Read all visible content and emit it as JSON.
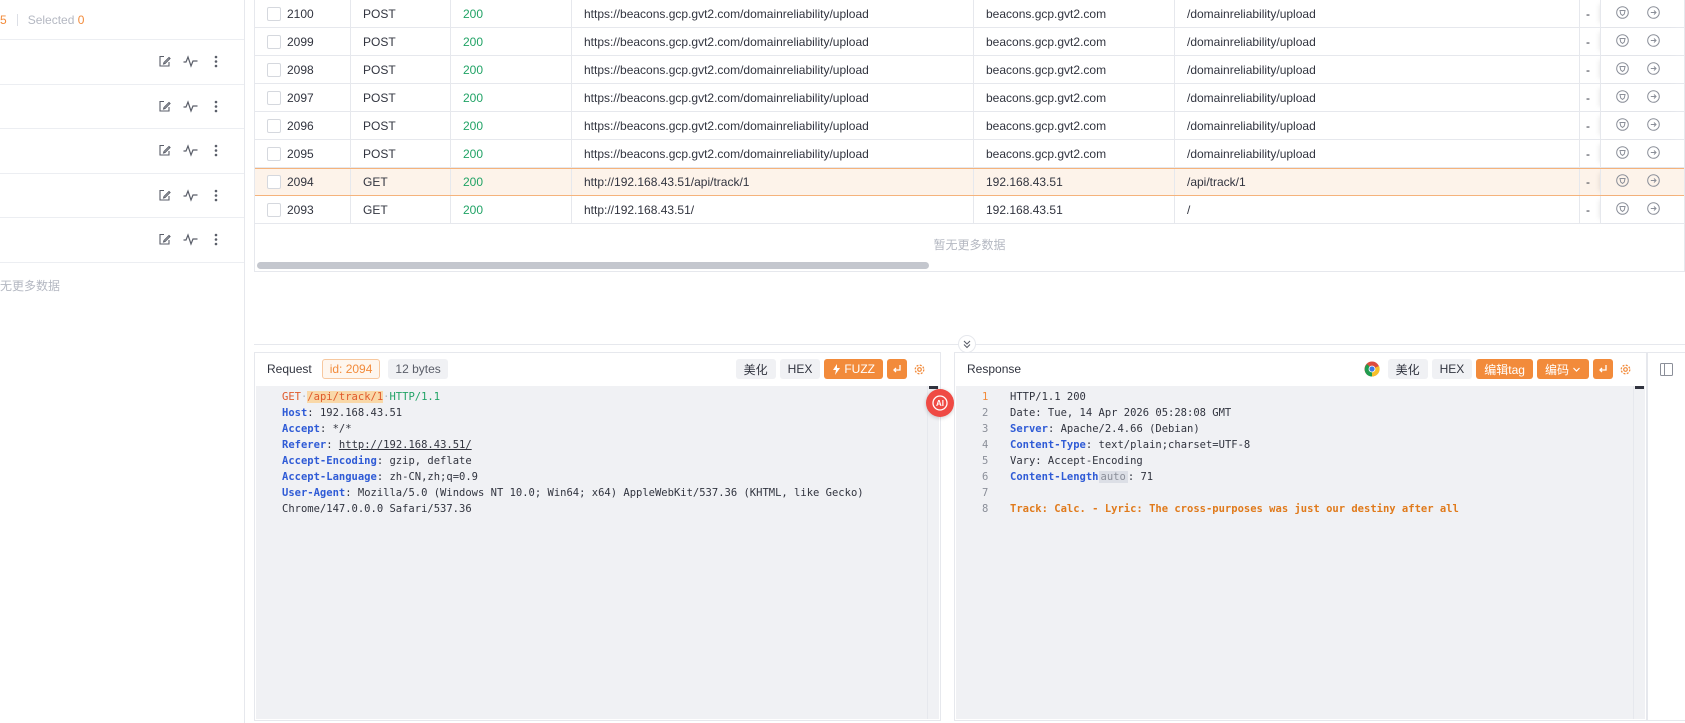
{
  "left_panel": {
    "count": "5",
    "selected_label": "Selected",
    "selected_count": "0",
    "empty_text": "无更多数据",
    "item_count": 5
  },
  "table": {
    "rows": [
      {
        "id": "2100",
        "method": "POST",
        "status": "200",
        "url": "https://beacons.gcp.gvt2.com/domainreliability/upload",
        "host": "beacons.gcp.gvt2.com",
        "path": "/domainreliability/upload",
        "extra": "-"
      },
      {
        "id": "2099",
        "method": "POST",
        "status": "200",
        "url": "https://beacons.gcp.gvt2.com/domainreliability/upload",
        "host": "beacons.gcp.gvt2.com",
        "path": "/domainreliability/upload",
        "extra": "-"
      },
      {
        "id": "2098",
        "method": "POST",
        "status": "200",
        "url": "https://beacons.gcp.gvt2.com/domainreliability/upload",
        "host": "beacons.gcp.gvt2.com",
        "path": "/domainreliability/upload",
        "extra": "-"
      },
      {
        "id": "2097",
        "method": "POST",
        "status": "200",
        "url": "https://beacons.gcp.gvt2.com/domainreliability/upload",
        "host": "beacons.gcp.gvt2.com",
        "path": "/domainreliability/upload",
        "extra": "-"
      },
      {
        "id": "2096",
        "method": "POST",
        "status": "200",
        "url": "https://beacons.gcp.gvt2.com/domainreliability/upload",
        "host": "beacons.gcp.gvt2.com",
        "path": "/domainreliability/upload",
        "extra": "-"
      },
      {
        "id": "2095",
        "method": "POST",
        "status": "200",
        "url": "https://beacons.gcp.gvt2.com/domainreliability/upload",
        "host": "beacons.gcp.gvt2.com",
        "path": "/domainreliability/upload",
        "extra": "-"
      },
      {
        "id": "2094",
        "method": "GET",
        "status": "200",
        "url": "http://192.168.43.51/api/track/1",
        "host": "192.168.43.51",
        "path": "/api/track/1",
        "extra": "-",
        "selected": true
      },
      {
        "id": "2093",
        "method": "GET",
        "status": "200",
        "url": "http://192.168.43.51/",
        "host": "192.168.43.51",
        "path": "/",
        "extra": "-"
      }
    ],
    "empty_text": "暂无更多数据"
  },
  "request": {
    "title": "Request",
    "id_tag": "id: 2094",
    "bytes_tag": "12 bytes",
    "btn_beautify": "美化",
    "btn_hex": "HEX",
    "btn_fuzz": "FUZZ",
    "line1": {
      "method": "GET",
      "path": "/api/track/1",
      "proto": "HTTP/1.1"
    },
    "headers": [
      {
        "k": "Host",
        "v": "192.168.43.51"
      },
      {
        "k": "Accept",
        "v": "*/*"
      },
      {
        "k": "Referer",
        "v": "http://192.168.43.51/"
      },
      {
        "k": "Accept-Encoding",
        "v": "gzip, deflate"
      },
      {
        "k": "Accept-Language",
        "v": "zh-CN,zh;q=0.9"
      },
      {
        "k": "User-Agent",
        "v": "Mozilla/5.0 (Windows NT 10.0; Win64; x64) AppleWebKit/537.36 (KHTML, like Gecko)"
      }
    ],
    "ua_cont": "Chrome/147.0.0.0 Safari/537.36"
  },
  "response": {
    "title": "Response",
    "btn_beautify": "美化",
    "btn_hex": "HEX",
    "btn_edit_tag": "编辑tag",
    "btn_encode": "编码",
    "status_line": "HTTP/1.1 200",
    "date": "Date: Tue, 14 Apr 2026 05:28:08 GMT",
    "headers": [
      {
        "k": "Server",
        "v": "Apache/2.4.66 (Debian)"
      },
      {
        "k": "Content-Type",
        "v": "text/plain;charset=UTF-8"
      }
    ],
    "vary": "Vary: Accept-Encoding",
    "content_length_key": "Content-Length",
    "content_length_tag": "auto",
    "content_length_val": "71",
    "body": "Track: Calc. - Lyric: The cross-purposes was just our destiny after all",
    "line_numbers": [
      "1",
      "2",
      "3",
      "4",
      "5",
      "6",
      "7",
      "8"
    ]
  },
  "colors": {
    "accent": "#f28b3b",
    "status_ok": "#21a366",
    "header_key": "#2f5bd6",
    "ai_button": "#ef4a44"
  }
}
